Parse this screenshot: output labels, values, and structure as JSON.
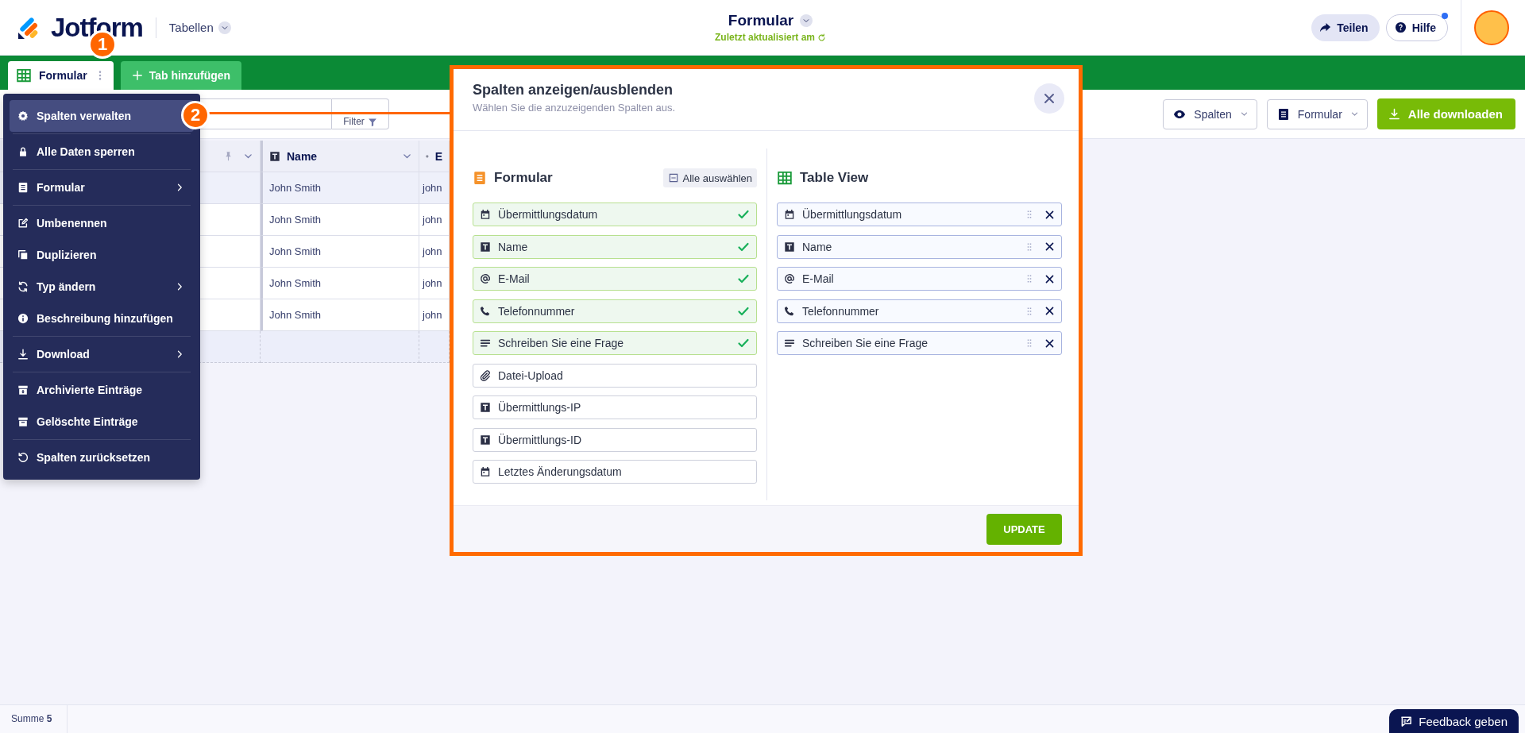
{
  "header": {
    "logo": "Jotform",
    "section": "Tabellen",
    "title": "Formular",
    "subtitle": "Zuletzt aktualisiert am",
    "buttons": [
      {
        "label": "Teilen",
        "kind": "share",
        "notification": false
      },
      {
        "label": "Hilfe",
        "kind": "help",
        "notification": true
      }
    ]
  },
  "tabs": [
    {
      "label": "Formular",
      "selected": true
    }
  ],
  "add_tab": "Tab hinzufügen",
  "toolbar": {
    "filter": "Filter",
    "dropdowns": [
      {
        "label": "Spalten",
        "kind": "columns"
      },
      {
        "label": "Formular",
        "kind": "form"
      }
    ],
    "download": "Alle downloaden"
  },
  "table": {
    "columns": [
      {
        "kind": "pinned"
      },
      {
        "label": "Name",
        "kind": "text"
      },
      {
        "label": "E",
        "kind": "email"
      }
    ],
    "rows": [
      {
        "highlighted": true,
        "cells": [
          "",
          "John Smith",
          "john"
        ]
      },
      {
        "highlighted": false,
        "cells": [
          "",
          "John Smith",
          "john"
        ]
      },
      {
        "highlighted": false,
        "cells": [
          "",
          "John Smith",
          "john"
        ]
      },
      {
        "highlighted": false,
        "cells": [
          "",
          "John Smith",
          "john"
        ]
      },
      {
        "highlighted": false,
        "cells": [
          "",
          "John Smith",
          "john"
        ]
      }
    ]
  },
  "menu": {
    "groups": [
      {
        "items": [
          {
            "label": "Spalten verwalten",
            "selected": true,
            "submenu": false
          }
        ]
      },
      {
        "items": [
          {
            "label": "Alle Daten sperren",
            "selected": false,
            "submenu": false
          }
        ]
      },
      {
        "items": [
          {
            "label": "Formular",
            "selected": false,
            "submenu": true
          }
        ]
      },
      {
        "items": [
          {
            "label": "Umbenennen",
            "selected": false,
            "submenu": false
          },
          {
            "label": "Duplizieren",
            "selected": false,
            "submenu": false
          },
          {
            "label": "Typ ändern",
            "selected": false,
            "submenu": true
          },
          {
            "label": "Beschreibung hinzufügen",
            "selected": false,
            "submenu": false
          }
        ]
      },
      {
        "items": [
          {
            "label": "Download",
            "selected": false,
            "submenu": true
          }
        ]
      },
      {
        "items": [
          {
            "label": "Archivierte Einträge",
            "selected": false,
            "submenu": false
          },
          {
            "label": "Gelöschte Einträge",
            "selected": false,
            "submenu": false
          }
        ]
      },
      {
        "items": [
          {
            "label": "Spalten zurücksetzen",
            "selected": false,
            "submenu": false
          }
        ]
      }
    ]
  },
  "annotations": [
    {
      "label": "1"
    },
    {
      "label": "2"
    }
  ],
  "modal": {
    "title": "Spalten anzeigen/ausblenden",
    "subtitle": "Wählen Sie die anzuzeigenden Spalten aus.",
    "source": {
      "title": "Formular",
      "select_all": {
        "label": "Alle auswählen",
        "indeterminate": true
      },
      "fields": [
        {
          "label": "Übermittlungsdatum",
          "kind": "date",
          "checked": true
        },
        {
          "label": "Name",
          "kind": "text",
          "checked": true
        },
        {
          "label": "E-Mail",
          "kind": "email",
          "checked": true
        },
        {
          "label": "Telefonnummer",
          "kind": "phone",
          "checked": true
        },
        {
          "label": "Schreiben Sie eine Frage",
          "kind": "question",
          "checked": true
        },
        {
          "label": "Datei-Upload",
          "kind": "upload",
          "checked": false
        },
        {
          "label": "Übermittlungs-IP",
          "kind": "text",
          "checked": false
        },
        {
          "label": "Übermittlungs-ID",
          "kind": "text",
          "checked": false
        },
        {
          "label": "Letztes Änderungsdatum",
          "kind": "date",
          "checked": false
        }
      ]
    },
    "target": {
      "title": "Table View",
      "fields": [
        {
          "label": "Übermittlungsdatum",
          "kind": "date"
        },
        {
          "label": "Name",
          "kind": "text"
        },
        {
          "label": "E-Mail",
          "kind": "email"
        },
        {
          "label": "Telefonnummer",
          "kind": "phone"
        },
        {
          "label": "Schreiben Sie eine Frage",
          "kind": "question"
        }
      ]
    },
    "button": "UPDATE"
  },
  "status_bar": {
    "sum": "Summe **5**",
    "feedback": "Feedback geben"
  }
}
